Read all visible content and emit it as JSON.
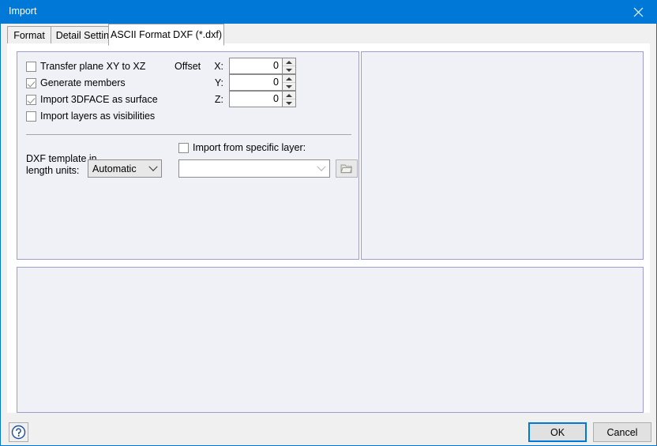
{
  "window": {
    "title": "Import",
    "close_icon": "close-icon"
  },
  "tabs": [
    {
      "label": "Format",
      "active": false
    },
    {
      "label": "Detail Settings",
      "active": false
    },
    {
      "label": "ASCII Format DXF (*.dxf)",
      "active": true
    }
  ],
  "options": {
    "checkboxes": [
      {
        "label": "Transfer plane XY to XZ",
        "checked": false
      },
      {
        "label": "Generate members",
        "checked": true
      },
      {
        "label": "Import 3DFACE as surface",
        "checked": true
      },
      {
        "label": "Import layers as visibilities",
        "checked": false
      }
    ]
  },
  "offset": {
    "group_label": "Offset",
    "fields": [
      {
        "axis": "X:",
        "value": "0"
      },
      {
        "axis": "Y:",
        "value": "0"
      },
      {
        "axis": "Z:",
        "value": "0"
      }
    ]
  },
  "template": {
    "label_line1": "DXF template in",
    "label_line2": "length units:",
    "selected": "Automatic"
  },
  "layer": {
    "checkbox_label": "Import from specific layer:",
    "checked": false,
    "combo_value": "",
    "browse_icon": "open-folder-icon"
  },
  "footer": {
    "help_icon": "help-question-icon",
    "ok_label": "OK",
    "cancel_label": "Cancel"
  },
  "colors": {
    "accent": "#0078d7",
    "panel_border": "#9e9ece",
    "panel_fill": "#eff1f7",
    "dialog_bg": "#f0f0f0"
  }
}
